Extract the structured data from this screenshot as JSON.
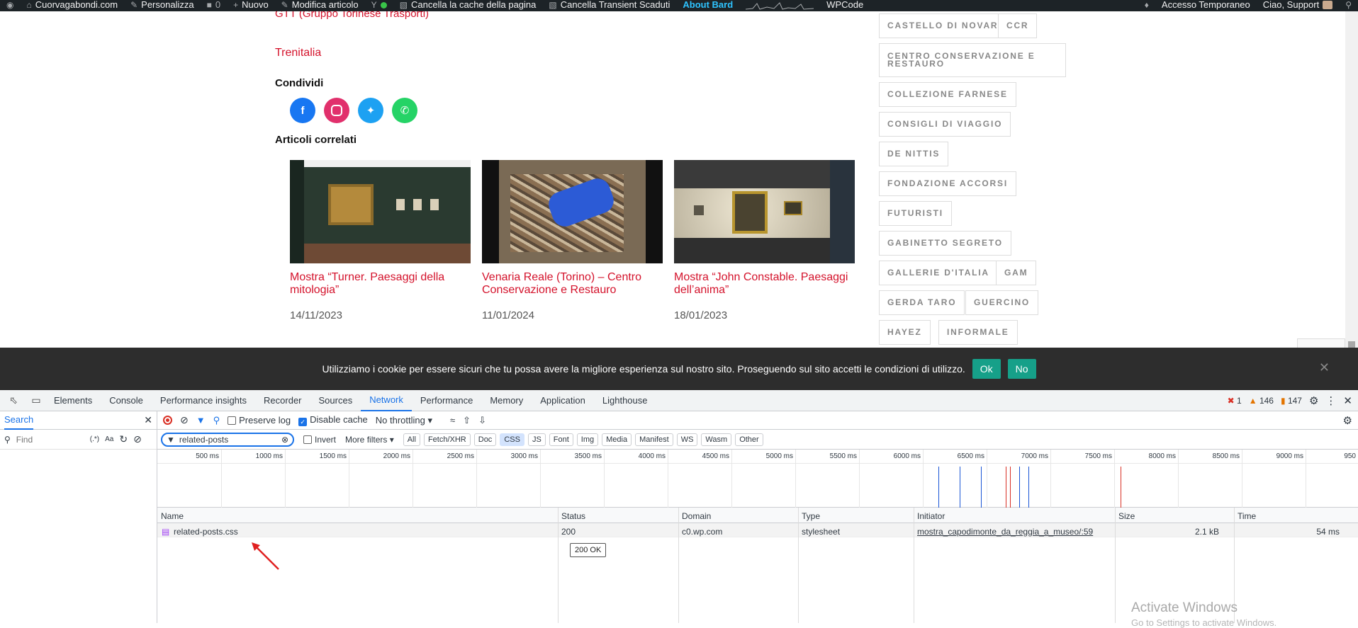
{
  "admin_bar": {
    "site": "Cuorvagabondi.com",
    "customize": "Personalizza",
    "comments": "0",
    "new": "Nuovo",
    "edit": "Modifica articolo",
    "clear_cache": "Cancella la cache della pagina",
    "clear_transient": "Cancella Transient Scaduti",
    "about": "About Bard",
    "wpcode": "WPCode",
    "temp_access": "Accesso Temporaneo",
    "greeting": "Ciao, Support"
  },
  "article": {
    "gtt_link": "GTT (Gruppo Torinese Trasporti)",
    "trenitalia_link": "Trenitalia",
    "share_heading": "Condividi",
    "related_heading": "Articoli correlati",
    "related": [
      {
        "title": "Mostra “Turner. Paesaggi della mitologia”",
        "date": "14/11/2023"
      },
      {
        "title": "Venaria Reale (Torino) – Centro Conservazione e Restauro",
        "date": "11/01/2024"
      },
      {
        "title": "Mostra “John Constable. Paesaggi dell’anima”",
        "date": "18/01/2023"
      }
    ]
  },
  "tags": [
    "CASTELLO DI NOVARA",
    "CCR",
    "CENTRO CONSERVAZIONE E RESTAURO",
    "COLLEZIONE FARNESE",
    "CONSIGLI DI VIAGGIO",
    "DE NITTIS",
    "FONDAZIONE ACCORSI",
    "FUTURISTI",
    "GABINETTO SEGRETO",
    "GALLERIE D'ITALIA",
    "GAM",
    "GERDA TARO",
    "GUERCINO",
    "HAYEZ",
    "INFORMALE"
  ],
  "cookie": {
    "text": "Utilizziamo i cookie per essere sicuri che tu possa avere la migliore esperienza sul nostro sito. Proseguendo sul sito accetti le condizioni di utilizzo.",
    "ok": "Ok",
    "no": "No"
  },
  "devtools": {
    "tabs": [
      "Elements",
      "Console",
      "Performance insights",
      "Recorder",
      "Sources",
      "Network",
      "Performance",
      "Memory",
      "Application",
      "Lighthouse"
    ],
    "active_tab": "Network",
    "errors": "1",
    "warnings": "146",
    "issues": "147",
    "search_tab": "Search",
    "find_placeholder": "Find",
    "regex": "(.*)",
    "case": "Aa",
    "preserve_log": "Preserve log",
    "disable_cache": "Disable cache",
    "throttling": "No throttling",
    "filter_value": "related-posts",
    "invert": "Invert",
    "more_filters": "More filters",
    "type_filters": [
      "All",
      "Fetch/XHR",
      "Doc",
      "CSS",
      "JS",
      "Font",
      "Img",
      "Media",
      "Manifest",
      "WS",
      "Wasm",
      "Other"
    ],
    "active_filter": "CSS",
    "timeline_ticks": [
      "500 ms",
      "1000 ms",
      "1500 ms",
      "2000 ms",
      "2500 ms",
      "3000 ms",
      "3500 ms",
      "4000 ms",
      "4500 ms",
      "5000 ms",
      "5500 ms",
      "6000 ms",
      "6500 ms",
      "7000 ms",
      "7500 ms",
      "8000 ms",
      "8500 ms",
      "9000 ms",
      "950"
    ],
    "columns": [
      "Name",
      "Status",
      "Domain",
      "Type",
      "Initiator",
      "Size",
      "Time"
    ],
    "row": {
      "name": "related-posts.css",
      "status": "200",
      "domain": "c0.wp.com",
      "type": "stylesheet",
      "initiator": "mostra_capodimonte_da_reggia_a_museo/:59",
      "size": "2.1 kB",
      "time": "54 ms"
    },
    "tooltip": "200 OK"
  },
  "watermark": {
    "line1": "Activate Windows",
    "line2": "Go to Settings to activate Windows."
  },
  "colors": {
    "accent_red": "#d4122b",
    "devtools_blue": "#1a73e8",
    "cookie_button": "#16a089",
    "admin_bar": "#1d2327"
  }
}
